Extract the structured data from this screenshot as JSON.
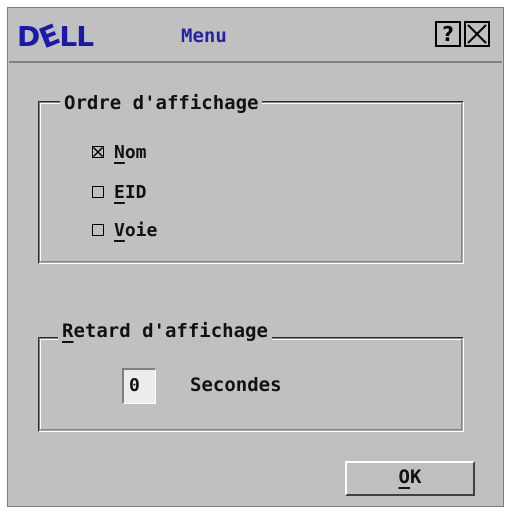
{
  "window": {
    "logo": {
      "pre": "D",
      "e": "E",
      "post": "LL"
    },
    "title": "Menu",
    "help_label": "?",
    "close_icon": "close-icon"
  },
  "display_order": {
    "legend": "Ordre d'affichage",
    "options": [
      {
        "mnemonic": "N",
        "rest": "om",
        "checked": true
      },
      {
        "mnemonic": "E",
        "rest": "ID",
        "checked": false
      },
      {
        "mnemonic": "V",
        "rest": "oie",
        "checked": false
      }
    ]
  },
  "display_delay": {
    "legend_mnemonic": "R",
    "legend_rest": "etard d'affichage",
    "value": "0",
    "unit": "Secondes"
  },
  "ok_button": {
    "mnemonic": "O",
    "rest": "K"
  },
  "colors": {
    "background": "#c0c0c0",
    "title_text": "#2323a6",
    "logo": "#1a1aa6",
    "field": "#ececec"
  }
}
